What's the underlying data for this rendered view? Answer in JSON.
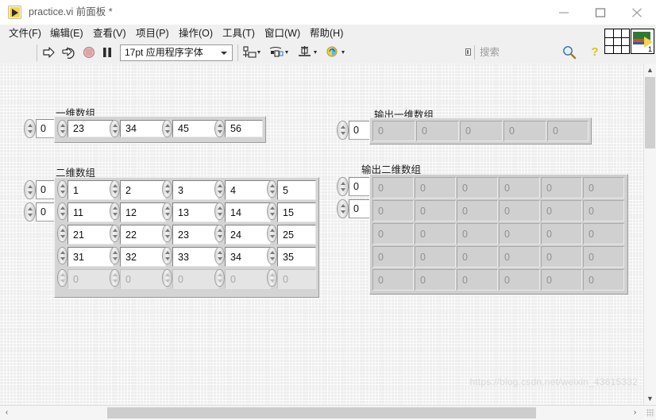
{
  "window": {
    "title": "practice.vi 前面板 *",
    "icon": "labview-vi-icon",
    "buttons": {
      "minimize": "—",
      "maximize": "□",
      "close": "✕"
    }
  },
  "menubar": {
    "items": [
      {
        "label": "文件(F)",
        "name": "menu-file"
      },
      {
        "label": "编辑(E)",
        "name": "menu-edit"
      },
      {
        "label": "查看(V)",
        "name": "menu-view"
      },
      {
        "label": "项目(P)",
        "name": "menu-project"
      },
      {
        "label": "操作(O)",
        "name": "menu-operate"
      },
      {
        "label": "工具(T)",
        "name": "menu-tools"
      },
      {
        "label": "窗口(W)",
        "name": "menu-window"
      },
      {
        "label": "帮助(H)",
        "name": "menu-help"
      }
    ]
  },
  "toolbar": {
    "run_icon": "run-arrow-icon",
    "run_continuous_icon": "run-continuously-icon",
    "abort_icon": "abort-execution-icon",
    "pause_icon": "pause-icon",
    "font_selector": "17pt 应用程序字体",
    "align_icon": "align-objects-icon",
    "distribute_icon": "distribute-objects-icon",
    "resize_icon": "resize-objects-icon",
    "reorder_icon": "reorder-objects-icon",
    "search_placeholder": "搜索",
    "search_icon": "magnifier-icon",
    "help_icon": "context-help-icon",
    "vi_icon_number": "1"
  },
  "panel": {
    "arrays": [
      {
        "name": "input-1d-array",
        "label": "一维数组",
        "kind": "control",
        "index_values": [
          "0"
        ],
        "values": [
          [
            "23",
            "34",
            "45",
            "56"
          ]
        ]
      },
      {
        "name": "output-1d-array",
        "label": "输出一维数组",
        "kind": "indicator",
        "index_values": [
          "0"
        ],
        "values": [
          [
            "0",
            "0",
            "0",
            "0",
            "0"
          ]
        ]
      },
      {
        "name": "input-2d-array",
        "label": "二维数组",
        "kind": "control",
        "index_values": [
          "0",
          "0"
        ],
        "values": [
          [
            "1",
            "2",
            "3",
            "4",
            "5"
          ],
          [
            "11",
            "12",
            "13",
            "14",
            "15"
          ],
          [
            "21",
            "22",
            "23",
            "24",
            "25"
          ],
          [
            "31",
            "32",
            "33",
            "34",
            "35"
          ],
          [
            "0",
            "0",
            "0",
            "0",
            "0"
          ]
        ],
        "dimmed_rows": [
          4
        ]
      },
      {
        "name": "output-2d-array",
        "label": "输出二维数组",
        "kind": "indicator",
        "index_values": [
          "0",
          "0"
        ],
        "values": [
          [
            "0",
            "0",
            "0",
            "0",
            "0",
            "0"
          ],
          [
            "0",
            "0",
            "0",
            "0",
            "0",
            "0"
          ],
          [
            "0",
            "0",
            "0",
            "0",
            "0",
            "0"
          ],
          [
            "0",
            "0",
            "0",
            "0",
            "0",
            "0"
          ],
          [
            "0",
            "0",
            "0",
            "0",
            "0",
            "0"
          ]
        ]
      }
    ]
  },
  "scrollbars": {
    "vertical_up": "▲",
    "vertical_down": "▼",
    "horizontal_left": "‹",
    "horizontal_right": "›"
  },
  "watermark": "https://blog.csdn.net/weixin_43615332",
  "colors": {
    "canvas": "#eeeeee",
    "grid_line": "#c9c9c9",
    "chrome": "#f0f0f0",
    "control_bg": "#ffffff",
    "indicator_bg": "#d0d0d0"
  }
}
